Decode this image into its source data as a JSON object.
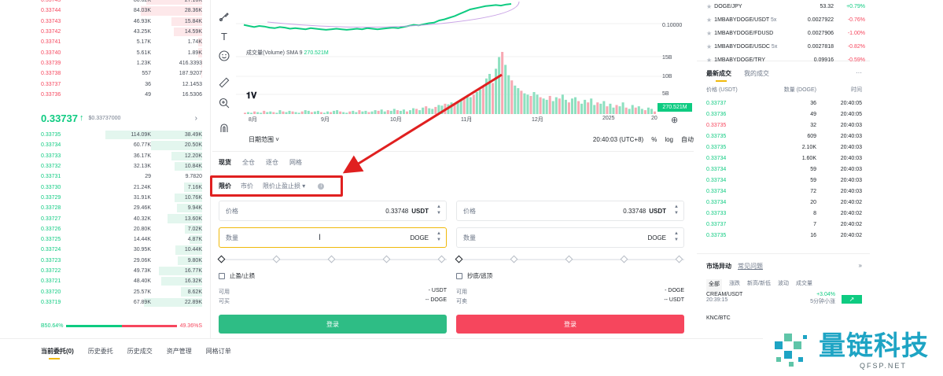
{
  "orderbook": {
    "asks": [
      {
        "price": "0.33745",
        "qty": "80.62K",
        "total": "27.16K",
        "fill": 0.55
      },
      {
        "price": "0.33744",
        "qty": "84.03K",
        "total": "28.36K",
        "fill": 0.6
      },
      {
        "price": "0.33743",
        "qty": "46.93K",
        "total": "15.84K",
        "fill": 0.3
      },
      {
        "price": "0.33742",
        "qty": "43.25K",
        "total": "14.59K",
        "fill": 0.28
      },
      {
        "price": "0.33741",
        "qty": "5.17K",
        "total": "1.74K",
        "fill": 0.04
      },
      {
        "price": "0.33740",
        "qty": "5.61K",
        "total": "1.89K",
        "fill": 0.04
      },
      {
        "price": "0.33739",
        "qty": "1.23K",
        "total": "416.3393",
        "fill": 0.01
      },
      {
        "price": "0.33738",
        "qty": "557",
        "total": "187.9207",
        "fill": 0.01
      },
      {
        "price": "0.33737",
        "qty": "36",
        "total": "12.1453",
        "fill": 0.0
      },
      {
        "price": "0.33736",
        "qty": "49",
        "total": "16.5306",
        "fill": 0.0
      }
    ],
    "last_price": "0.33737",
    "last_arrow": "↑",
    "ref_price": "$0.33737000",
    "go": "›",
    "bids": [
      {
        "price": "0.33735",
        "qty": "114.09K",
        "total": "38.49K",
        "fill": 0.95
      },
      {
        "price": "0.33734",
        "qty": "60.77K",
        "total": "20.50K",
        "fill": 0.5
      },
      {
        "price": "0.33733",
        "qty": "36.17K",
        "total": "12.20K",
        "fill": 0.3
      },
      {
        "price": "0.33732",
        "qty": "32.13K",
        "total": "10.84K",
        "fill": 0.27
      },
      {
        "price": "0.33731",
        "qty": "29",
        "total": "9.7820",
        "fill": 0.0
      },
      {
        "price": "0.33730",
        "qty": "21.24K",
        "total": "7.16K",
        "fill": 0.18
      },
      {
        "price": "0.33729",
        "qty": "31.91K",
        "total": "10.76K",
        "fill": 0.27
      },
      {
        "price": "0.33728",
        "qty": "29.46K",
        "total": "9.94K",
        "fill": 0.25
      },
      {
        "price": "0.33727",
        "qty": "40.32K",
        "total": "13.60K",
        "fill": 0.34
      },
      {
        "price": "0.33726",
        "qty": "20.80K",
        "total": "7.02K",
        "fill": 0.17
      },
      {
        "price": "0.33725",
        "qty": "14.44K",
        "total": "4.87K",
        "fill": 0.12
      },
      {
        "price": "0.33724",
        "qty": "30.95K",
        "total": "10.44K",
        "fill": 0.26
      },
      {
        "price": "0.33723",
        "qty": "29.06K",
        "total": "9.80K",
        "fill": 0.24
      },
      {
        "price": "0.33722",
        "qty": "49.73K",
        "total": "16.77K",
        "fill": 0.42
      },
      {
        "price": "0.33721",
        "qty": "48.40K",
        "total": "16.32K",
        "fill": 0.4
      },
      {
        "price": "0.33720",
        "qty": "25.57K",
        "total": "8.62K",
        "fill": 0.21
      },
      {
        "price": "0.33719",
        "qty": "67.89K",
        "total": "22.89K",
        "fill": 0.57
      }
    ],
    "buy_ratio_label": "B",
    "buy_ratio": "50.64%",
    "sell_ratio": "49.36%",
    "sell_ratio_label": "S",
    "buy_ratio_value": 0.5064
  },
  "bottom_tabs": [
    "当前委托(0)",
    "历史委托",
    "历史成交",
    "资产管理",
    "网格订单"
  ],
  "chart": {
    "volume_label": "成交量(Volume) SMA 9",
    "volume_value": "270.521M",
    "volume_tag": "270.521M",
    "price_axis": [
      "0.10000",
      "15B",
      "10B",
      "5B"
    ],
    "x_axis": [
      "8月",
      "9月",
      "10月",
      "11月",
      "12月",
      "2025",
      "20"
    ],
    "footer_left": "日期范围 ˅",
    "footer_time": "20:40:03 (UTC+8)",
    "footer_pct": "%",
    "footer_log": "log",
    "footer_auto": "自动",
    "volumes": [
      2,
      3,
      2,
      4,
      3,
      2,
      5,
      3,
      4,
      3,
      2,
      6,
      4,
      3,
      5,
      4,
      3,
      2,
      4,
      6,
      5,
      3,
      4,
      5,
      3,
      2,
      4,
      3,
      5,
      6,
      4,
      3,
      2,
      4,
      5,
      3,
      6,
      4,
      5,
      3,
      4,
      6,
      5,
      7,
      4,
      6,
      5,
      8,
      6,
      5,
      7,
      4,
      6,
      9,
      8,
      6,
      10,
      12,
      9,
      8,
      11,
      14,
      13,
      16,
      15,
      18,
      17,
      20,
      22,
      24,
      28,
      26,
      30,
      34,
      38,
      42,
      55,
      62,
      48,
      70,
      88,
      96,
      76,
      60,
      52,
      44,
      40,
      36,
      32,
      30,
      28,
      34,
      30,
      26,
      24,
      22,
      28,
      20,
      26,
      24,
      30,
      22,
      18,
      24,
      26,
      20,
      16,
      22,
      18,
      24,
      14,
      18,
      16,
      20,
      12,
      16,
      10,
      14,
      12,
      18,
      10,
      8,
      14,
      10,
      12,
      8,
      6,
      10,
      8,
      4
    ],
    "price_line": [
      0.62,
      0.6,
      0.58,
      0.6,
      0.59,
      0.57,
      0.56,
      0.58,
      0.57,
      0.55,
      0.56,
      0.55,
      0.54,
      0.56,
      0.55,
      0.54,
      0.53,
      0.54,
      0.55,
      0.54,
      0.53,
      0.54,
      0.55,
      0.54,
      0.56,
      0.55,
      0.54,
      0.55,
      0.56,
      0.57,
      0.56,
      0.58,
      0.6,
      0.62,
      0.61,
      0.63,
      0.65,
      0.66,
      0.7,
      0.72,
      0.75,
      0.78,
      0.82,
      0.86,
      0.9,
      0.92,
      0.94,
      0.96,
      0.97,
      0.98,
      0.97,
      0.99,
      1.0
    ]
  },
  "order_form": {
    "mode_tabs": [
      "现货",
      "全仓",
      "逐仓",
      "网格"
    ],
    "type_tabs": [
      "限价",
      "市价",
      "限价止盈止损 ▾"
    ],
    "info_icon": "i",
    "buy": {
      "price_label": "价格",
      "price_value": "0.33748",
      "price_unit": "USDT",
      "qty_label": "数量",
      "qty_unit": "DOGE",
      "tpsl_label": "止盈/止损",
      "avail_label": "可用",
      "avail_value": "- USDT",
      "max_label": "可买",
      "max_value": "-- DOGE",
      "button": "登录"
    },
    "sell": {
      "price_label": "价格",
      "price_value": "0.33748",
      "price_unit": "USDT",
      "qty_label": "数量",
      "qty_unit": "DOGE",
      "tpsl_label": "抄底/逃顶",
      "avail_label": "可用",
      "avail_value": "- DOGE",
      "max_label": "可卖",
      "max_value": "-- USDT",
      "button": "登录"
    }
  },
  "pairs": [
    {
      "name": "DOGE/JPY",
      "lev": "",
      "price": "53.32",
      "change": "+0.79%",
      "dir": "up"
    },
    {
      "name": "1MBABYDOGE/USDT",
      "lev": "5x",
      "price": "0.0027922",
      "change": "-0.76%",
      "dir": "dn"
    },
    {
      "name": "1MBABYDOGE/FDUSD",
      "lev": "",
      "price": "0.0027906",
      "change": "-1.00%",
      "dir": "dn"
    },
    {
      "name": "1MBABYDOGE/USDC",
      "lev": "5x",
      "price": "0.0027818",
      "change": "-0.82%",
      "dir": "dn"
    },
    {
      "name": "1MBABYDOGE/TRY",
      "lev": "",
      "price": "0.09916",
      "change": "-0.59%",
      "dir": "dn"
    }
  ],
  "trades": {
    "tabs": [
      "最新成交",
      "我的成交"
    ],
    "more": "···",
    "head": {
      "price": "价格 (USDT)",
      "qty": "数量 (DOGE)",
      "time": "时间"
    },
    "rows": [
      {
        "price": "0.33737",
        "qty": "36",
        "time": "20:40:05",
        "dir": "up"
      },
      {
        "price": "0.33736",
        "qty": "49",
        "time": "20:40:05",
        "dir": "up"
      },
      {
        "price": "0.33735",
        "qty": "32",
        "time": "20:40:03",
        "dir": "dn"
      },
      {
        "price": "0.33735",
        "qty": "609",
        "time": "20:40:03",
        "dir": "up"
      },
      {
        "price": "0.33735",
        "qty": "2.10K",
        "time": "20:40:03",
        "dir": "up"
      },
      {
        "price": "0.33734",
        "qty": "1.60K",
        "time": "20:40:03",
        "dir": "up"
      },
      {
        "price": "0.33734",
        "qty": "59",
        "time": "20:40:03",
        "dir": "up"
      },
      {
        "price": "0.33734",
        "qty": "59",
        "time": "20:40:03",
        "dir": "up"
      },
      {
        "price": "0.33734",
        "qty": "72",
        "time": "20:40:03",
        "dir": "up"
      },
      {
        "price": "0.33734",
        "qty": "20",
        "time": "20:40:02",
        "dir": "up"
      },
      {
        "price": "0.33733",
        "qty": "8",
        "time": "20:40:02",
        "dir": "up"
      },
      {
        "price": "0.33737",
        "qty": "7",
        "time": "20:40:02",
        "dir": "up"
      },
      {
        "price": "0.33735",
        "qty": "16",
        "time": "20:40:02",
        "dir": "up"
      }
    ]
  },
  "movers": {
    "title": "市场异动",
    "link": "常见问题",
    "fold": "»",
    "tabs": [
      "全部",
      "涨跌",
      "新高/新低",
      "波动",
      "成交量"
    ],
    "rows": [
      {
        "pair": "CREAM/USDT",
        "time": "20:39:15",
        "change": "+3.04%",
        "sub": "5分钟小涨",
        "arrow": "↗"
      }
    ],
    "next_pair": "KNC/BTC"
  },
  "watermark": {
    "name": "量链科技",
    "url": "QFSP.NET"
  },
  "colors": {
    "buy": "#0ecb81",
    "sell": "#f6465d",
    "accent": "#f0b90b",
    "highlight": "#e02020"
  }
}
